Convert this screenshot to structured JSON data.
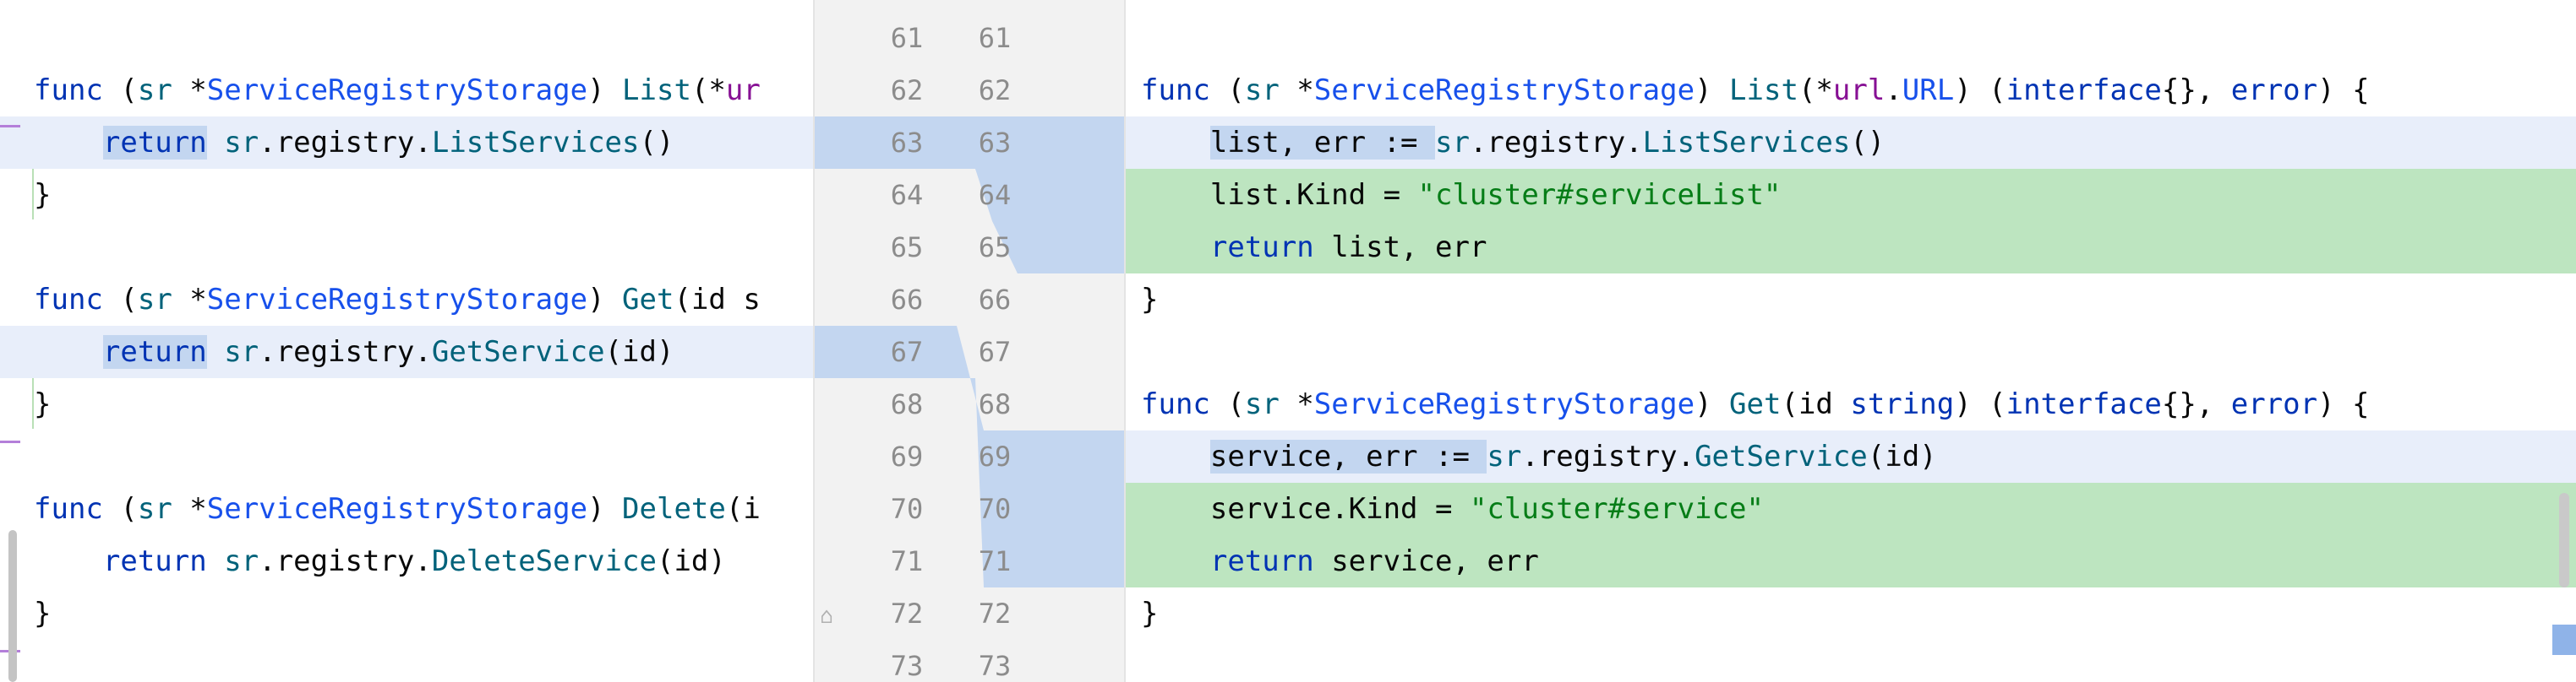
{
  "left_lines": [
    {
      "line": 61,
      "tokens": []
    },
    {
      "line": 62,
      "tokens": [
        {
          "t": "func",
          "c": "kw"
        },
        {
          "t": " (",
          "c": "plain"
        },
        {
          "t": "sr",
          "c": "param"
        },
        {
          "t": " *",
          "c": "plain"
        },
        {
          "t": "ServiceRegistryStorage",
          "c": "ty"
        },
        {
          "t": ") ",
          "c": "plain"
        },
        {
          "t": "List",
          "c": "fn"
        },
        {
          "t": "(*",
          "c": "plain"
        },
        {
          "t": "ur",
          "c": "pkg"
        }
      ]
    },
    {
      "line": 63,
      "tokens": [
        {
          "t": "    ",
          "c": "plain"
        },
        {
          "t": "return",
          "c": "kw",
          "word": true
        },
        {
          "t": " ",
          "c": "plain"
        },
        {
          "t": "sr",
          "c": "param"
        },
        {
          "t": ".registry.",
          "c": "plain"
        },
        {
          "t": "ListServices",
          "c": "fn"
        },
        {
          "t": "()",
          "c": "plain"
        }
      ]
    },
    {
      "line": 64,
      "tokens": [
        {
          "t": "}",
          "c": "plain"
        }
      ]
    },
    {
      "line": 65,
      "tokens": []
    },
    {
      "line": 66,
      "tokens": [
        {
          "t": "func",
          "c": "kw"
        },
        {
          "t": " (",
          "c": "plain"
        },
        {
          "t": "sr",
          "c": "param"
        },
        {
          "t": " *",
          "c": "plain"
        },
        {
          "t": "ServiceRegistryStorage",
          "c": "ty"
        },
        {
          "t": ") ",
          "c": "plain"
        },
        {
          "t": "Get",
          "c": "fn"
        },
        {
          "t": "(id s",
          "c": "plain"
        }
      ]
    },
    {
      "line": 67,
      "tokens": [
        {
          "t": "    ",
          "c": "plain"
        },
        {
          "t": "return",
          "c": "kw",
          "word": true
        },
        {
          "t": " ",
          "c": "plain"
        },
        {
          "t": "sr",
          "c": "param"
        },
        {
          "t": ".registry.",
          "c": "plain"
        },
        {
          "t": "GetService",
          "c": "fn"
        },
        {
          "t": "(id)",
          "c": "plain"
        }
      ]
    },
    {
      "line": 68,
      "tokens": [
        {
          "t": "}",
          "c": "plain"
        }
      ]
    },
    {
      "line": 69,
      "tokens": []
    },
    {
      "line": 70,
      "tokens": [
        {
          "t": "func",
          "c": "kw"
        },
        {
          "t": " (",
          "c": "plain"
        },
        {
          "t": "sr",
          "c": "param"
        },
        {
          "t": " *",
          "c": "plain"
        },
        {
          "t": "ServiceRegistryStorage",
          "c": "ty"
        },
        {
          "t": ") ",
          "c": "plain"
        },
        {
          "t": "Delete",
          "c": "fn"
        },
        {
          "t": "(i",
          "c": "plain"
        }
      ]
    },
    {
      "line": 71,
      "tokens": [
        {
          "t": "    ",
          "c": "plain"
        },
        {
          "t": "return",
          "c": "kw"
        },
        {
          "t": " ",
          "c": "plain"
        },
        {
          "t": "sr",
          "c": "param"
        },
        {
          "t": ".registry.",
          "c": "plain"
        },
        {
          "t": "DeleteService",
          "c": "fn"
        },
        {
          "t": "(id)",
          "c": "plain"
        }
      ]
    },
    {
      "line": 72,
      "tokens": [
        {
          "t": "}",
          "c": "plain"
        }
      ]
    },
    {
      "line": 73,
      "tokens": []
    }
  ],
  "right_lines": [
    {
      "line": 61,
      "tokens": []
    },
    {
      "line": 62,
      "tokens": [
        {
          "t": "func",
          "c": "kw"
        },
        {
          "t": " (",
          "c": "plain"
        },
        {
          "t": "sr",
          "c": "param"
        },
        {
          "t": " *",
          "c": "plain"
        },
        {
          "t": "ServiceRegistryStorage",
          "c": "ty"
        },
        {
          "t": ") ",
          "c": "plain"
        },
        {
          "t": "List",
          "c": "fn"
        },
        {
          "t": "(*",
          "c": "plain"
        },
        {
          "t": "url",
          "c": "pkg"
        },
        {
          "t": ".",
          "c": "plain"
        },
        {
          "t": "URL",
          "c": "ty"
        },
        {
          "t": ") (",
          "c": "plain"
        },
        {
          "t": "interface",
          "c": "kw"
        },
        {
          "t": "{}, ",
          "c": "plain"
        },
        {
          "t": "error",
          "c": "kw"
        },
        {
          "t": ") {",
          "c": "plain"
        }
      ]
    },
    {
      "line": 63,
      "tokens": [
        {
          "t": "    ",
          "c": "plain"
        },
        {
          "t": "list, err := ",
          "c": "plain",
          "word": true
        },
        {
          "t": "sr",
          "c": "param"
        },
        {
          "t": ".registry.",
          "c": "plain"
        },
        {
          "t": "ListServices",
          "c": "fn"
        },
        {
          "t": "()",
          "c": "plain"
        }
      ]
    },
    {
      "line": 64,
      "tokens": [
        {
          "t": "    list.Kind = ",
          "c": "plain"
        },
        {
          "t": "\"cluster#serviceList\"",
          "c": "str"
        }
      ]
    },
    {
      "line": 65,
      "tokens": [
        {
          "t": "    ",
          "c": "plain"
        },
        {
          "t": "return",
          "c": "kw"
        },
        {
          "t": " list, err",
          "c": "plain"
        }
      ]
    },
    {
      "line": 66,
      "tokens": [
        {
          "t": "}",
          "c": "plain"
        }
      ]
    },
    {
      "line": 67,
      "tokens": []
    },
    {
      "line": 68,
      "tokens": [
        {
          "t": "func",
          "c": "kw"
        },
        {
          "t": " (",
          "c": "plain"
        },
        {
          "t": "sr",
          "c": "param"
        },
        {
          "t": " *",
          "c": "plain"
        },
        {
          "t": "ServiceRegistryStorage",
          "c": "ty"
        },
        {
          "t": ") ",
          "c": "plain"
        },
        {
          "t": "Get",
          "c": "fn"
        },
        {
          "t": "(id ",
          "c": "plain"
        },
        {
          "t": "string",
          "c": "kw"
        },
        {
          "t": ") (",
          "c": "plain"
        },
        {
          "t": "interface",
          "c": "kw"
        },
        {
          "t": "{}, ",
          "c": "plain"
        },
        {
          "t": "error",
          "c": "kw"
        },
        {
          "t": ") {",
          "c": "plain"
        }
      ]
    },
    {
      "line": 69,
      "tokens": [
        {
          "t": "    ",
          "c": "plain"
        },
        {
          "t": "service, err := ",
          "c": "plain",
          "word": true
        },
        {
          "t": "sr",
          "c": "param"
        },
        {
          "t": ".registry.",
          "c": "plain"
        },
        {
          "t": "GetService",
          "c": "fn"
        },
        {
          "t": "(id)",
          "c": "plain"
        }
      ]
    },
    {
      "line": 70,
      "tokens": [
        {
          "t": "    service.Kind = ",
          "c": "plain"
        },
        {
          "t": "\"cluster#service\"",
          "c": "str"
        }
      ]
    },
    {
      "line": 71,
      "tokens": [
        {
          "t": "    ",
          "c": "plain"
        },
        {
          "t": "return",
          "c": "kw"
        },
        {
          "t": " service, err",
          "c": "plain"
        }
      ]
    },
    {
      "line": 72,
      "tokens": [
        {
          "t": "}",
          "c": "plain"
        }
      ]
    },
    {
      "line": 73,
      "tokens": []
    }
  ],
  "highlight_colors": {
    "changed": "#e8eefa",
    "added": "#bde5c0",
    "gutter_connector": "#c3d6f0",
    "gutter_bg": "#f2f2f2"
  }
}
